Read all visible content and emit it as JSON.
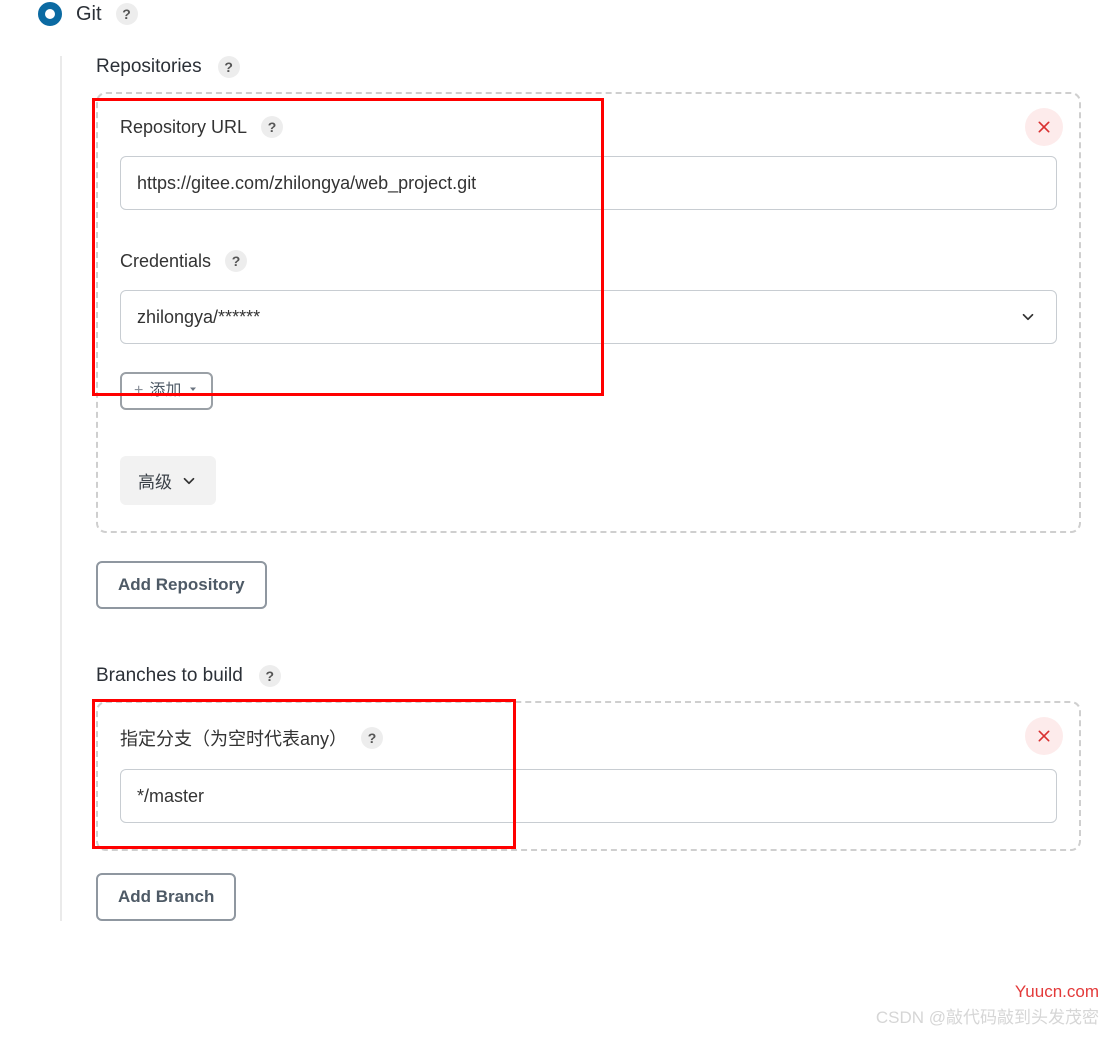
{
  "scm": {
    "option_label": "Git"
  },
  "repositories": {
    "heading": "Repositories",
    "repo_url_label": "Repository URL",
    "repo_url_value": "https://gitee.com/zhilongya/web_project.git",
    "credentials_label": "Credentials",
    "credentials_selected": "zhilongya/******",
    "add_dropdown_text": "添加",
    "advanced_label": "高级",
    "add_repo_button": "Add Repository"
  },
  "branches": {
    "heading": "Branches to build",
    "branch_spec_label": "指定分支（为空时代表any）",
    "branch_spec_value": "*/master",
    "add_branch_button": "Add Branch"
  },
  "watermarks": {
    "site": "Yuucn.com",
    "csdn": "CSDN @敲代码敲到头发茂密"
  }
}
